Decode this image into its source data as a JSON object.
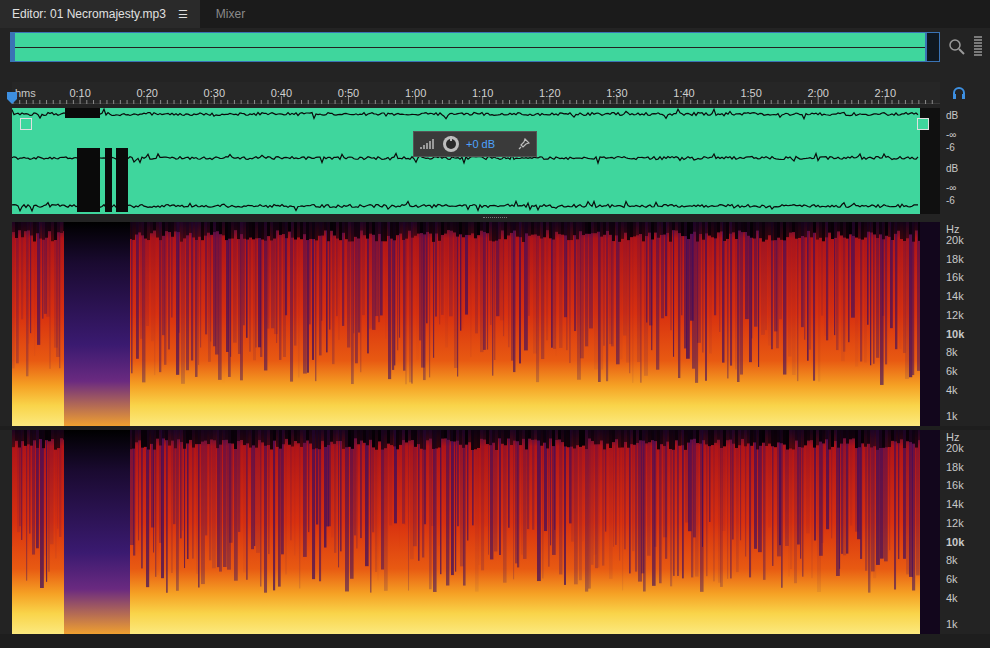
{
  "tabs": [
    {
      "label": "Editor: 01 Necromajesty.mp3",
      "menu": "☰",
      "selected": true
    },
    {
      "label": "Mixer",
      "selected": false
    }
  ],
  "ruler": {
    "unit": "hms",
    "ticks": [
      "0:10",
      "0:20",
      "0:30",
      "0:40",
      "0:50",
      "1:00",
      "1:10",
      "1:20",
      "1:30",
      "1:40",
      "1:50",
      "2:00",
      "2:10"
    ]
  },
  "waveform": {
    "channels": [
      {
        "scale": [
          "dB",
          "-∞",
          "-6"
        ]
      },
      {
        "scale": [
          "dB",
          "-∞",
          "-6"
        ]
      }
    ]
  },
  "hud": {
    "reading": "+0 dB"
  },
  "spectrogram": {
    "channels": [
      {
        "unit": "Hz",
        "ticks": [
          "20k",
          "18k",
          "16k",
          "14k",
          "12k",
          "10k",
          "8k",
          "6k",
          "4k",
          "1k"
        ]
      },
      {
        "unit": "Hz",
        "ticks": [
          "20k",
          "18k",
          "16k",
          "14k",
          "12k",
          "10k",
          "8k",
          "6k",
          "4k",
          "1k"
        ]
      }
    ]
  }
}
